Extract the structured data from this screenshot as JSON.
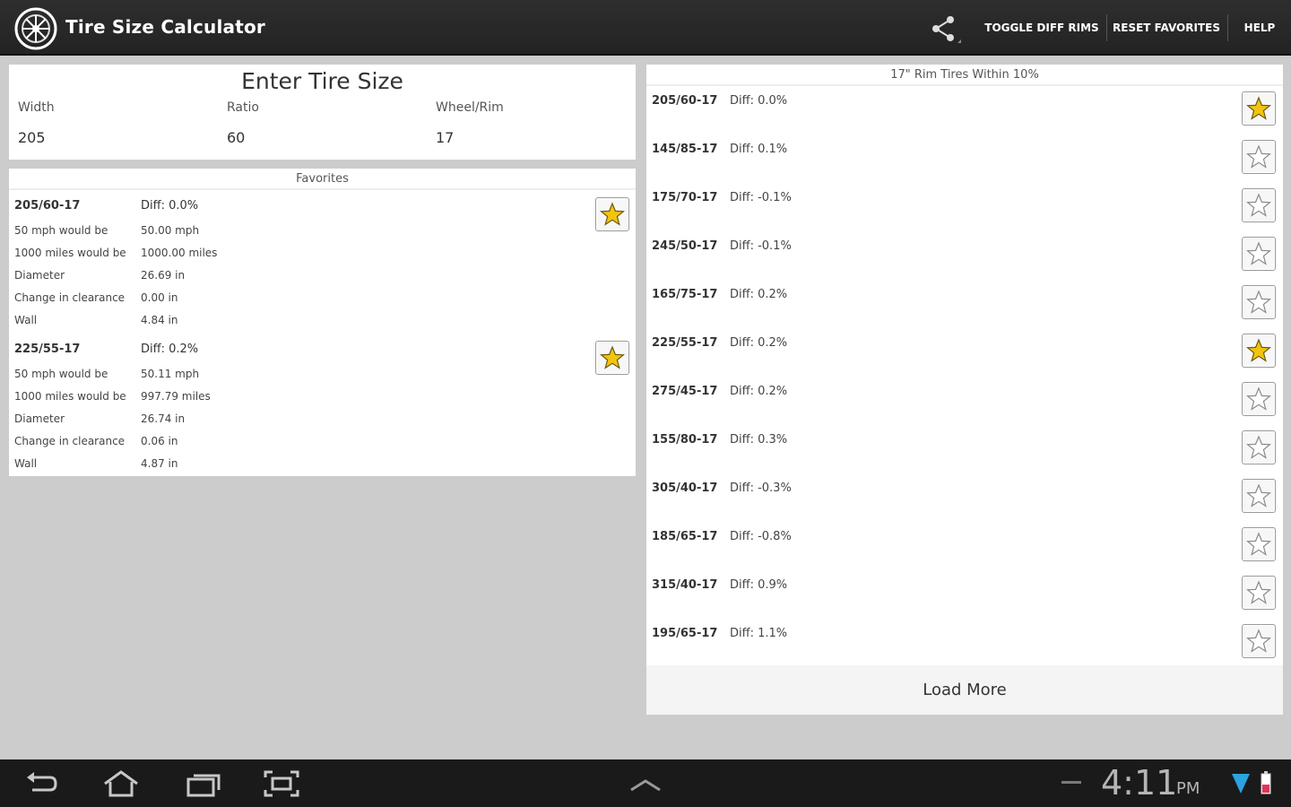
{
  "action_bar": {
    "title": "Tire Size Calculator",
    "buttons": [
      "TOGGLE DIFF RIMS",
      "RESET FAVORITES",
      "HELP"
    ]
  },
  "enter": {
    "title": "Enter Tire Size",
    "fields": [
      {
        "label": "Width",
        "value": "205"
      },
      {
        "label": "Ratio",
        "value": "60"
      },
      {
        "label": "Wheel/Rim",
        "value": "17"
      }
    ]
  },
  "favorites": {
    "header": "Favorites",
    "items": [
      {
        "size": "205/60-17",
        "diff": "Diff: 0.0%",
        "rows": [
          {
            "k": "50 mph would be",
            "v": "50.00 mph"
          },
          {
            "k": "1000 miles would be",
            "v": "1000.00 miles"
          },
          {
            "k": "Diameter",
            "v": "26.69 in"
          },
          {
            "k": "Change in clearance",
            "v": "0.00 in"
          },
          {
            "k": "Wall",
            "v": "4.84 in"
          }
        ]
      },
      {
        "size": "225/55-17",
        "diff": "Diff: 0.2%",
        "rows": [
          {
            "k": "50 mph would be",
            "v": "50.11 mph"
          },
          {
            "k": "1000 miles would be",
            "v": "997.79 miles"
          },
          {
            "k": "Diameter",
            "v": "26.74 in"
          },
          {
            "k": "Change in clearance",
            "v": "0.06 in"
          },
          {
            "k": "Wall",
            "v": "4.87 in"
          }
        ]
      }
    ]
  },
  "rim_list": {
    "header": "17\" Rim Tires Within 10%",
    "items": [
      {
        "size": "205/60-17",
        "diff": "Diff: 0.0%",
        "fav": true
      },
      {
        "size": "145/85-17",
        "diff": "Diff: 0.1%",
        "fav": false
      },
      {
        "size": "175/70-17",
        "diff": "Diff: -0.1%",
        "fav": false
      },
      {
        "size": "245/50-17",
        "diff": "Diff: -0.1%",
        "fav": false
      },
      {
        "size": "165/75-17",
        "diff": "Diff: 0.2%",
        "fav": false
      },
      {
        "size": "225/55-17",
        "diff": "Diff: 0.2%",
        "fav": true
      },
      {
        "size": "275/45-17",
        "diff": "Diff: 0.2%",
        "fav": false
      },
      {
        "size": "155/80-17",
        "diff": "Diff: 0.3%",
        "fav": false
      },
      {
        "size": "305/40-17",
        "diff": "Diff: -0.3%",
        "fav": false
      },
      {
        "size": "185/65-17",
        "diff": "Diff: -0.8%",
        "fav": false
      },
      {
        "size": "315/40-17",
        "diff": "Diff: 0.9%",
        "fav": false
      },
      {
        "size": "195/65-17",
        "diff": "Diff: 1.1%",
        "fav": false
      }
    ],
    "load_more": "Load More"
  },
  "system_bar": {
    "time": "4:11",
    "ampm": "PM",
    "icons": [
      "back-icon",
      "home-icon",
      "recent-apps-icon",
      "screenshot-icon",
      "chevron-up-icon",
      "wifi-icon",
      "battery-icon"
    ]
  },
  "colors": {
    "star_filled": "#f1c40f",
    "star_outline": "#9a9a9a",
    "action_bar": "#262626"
  }
}
